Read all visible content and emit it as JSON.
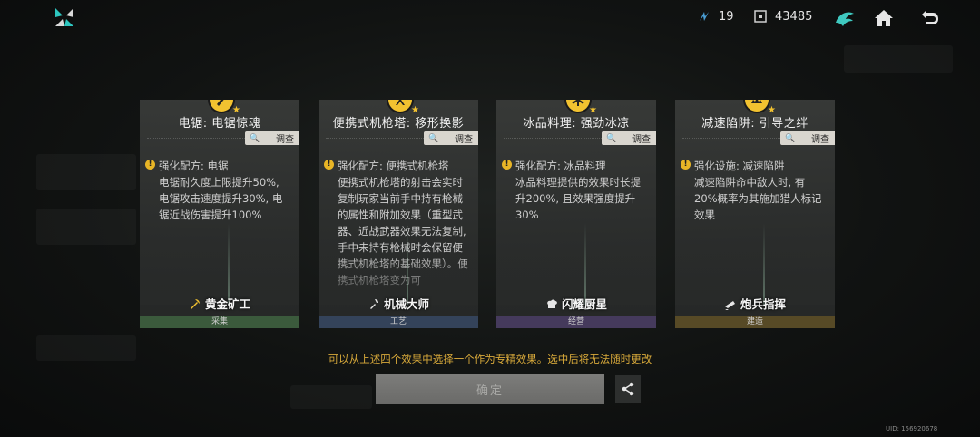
{
  "header": {
    "resource1": "19",
    "resource2": "43485"
  },
  "cards": [
    {
      "title": "电锯: 电锯惊魂",
      "inspect": "调查",
      "line1": "强化配方: 电锯",
      "body": "电锯耐久度上限提升50%, 电锯攻击速度提升30%, 电锯近战伤害提升100%",
      "role": "黄金矿工",
      "category": "采集",
      "category_color": "#3b5a3c",
      "role_icon": "pickaxe-icon"
    },
    {
      "title": "便携式机枪塔: 移形换影",
      "inspect": "调查",
      "line1": "强化配方: 便携式机枪塔",
      "body": "便携式机枪塔的射击会实时复制玩家当前手中持有枪械的属性和附加效果（重型武器、近战武器效果无法复制, 手中未持有枪械时会保留便携式机枪塔的基础效果）。便携式机枪塔变为可",
      "role": "机械大师",
      "category": "工艺",
      "category_color": "#34435a",
      "role_icon": "wrench-icon"
    },
    {
      "title": "冰品料理: 强劲冰凉",
      "inspect": "调查",
      "line1": "强化配方: 冰品料理",
      "body": "冰品料理提供的效果时长提升200%, 且效果强度提升30%",
      "role": "闪耀厨星",
      "category": "经营",
      "category_color": "#453a5c",
      "role_icon": "chef-icon"
    },
    {
      "title": "减速陷阱: 引导之绊",
      "inspect": "调查",
      "line1": "强化设施: 减速陷阱",
      "body": "减速陷阱命中敌人时, 有20%概率为其施加猎人标记效果",
      "role": "炮兵指挥",
      "category": "建造",
      "category_color": "#574a26",
      "role_icon": "cannon-icon"
    }
  ],
  "notice": "可以从上述四个效果中选择一个作为专精效果。选中后将无法随时更改",
  "confirm_label": "确定",
  "uid": "UID: 156920678"
}
